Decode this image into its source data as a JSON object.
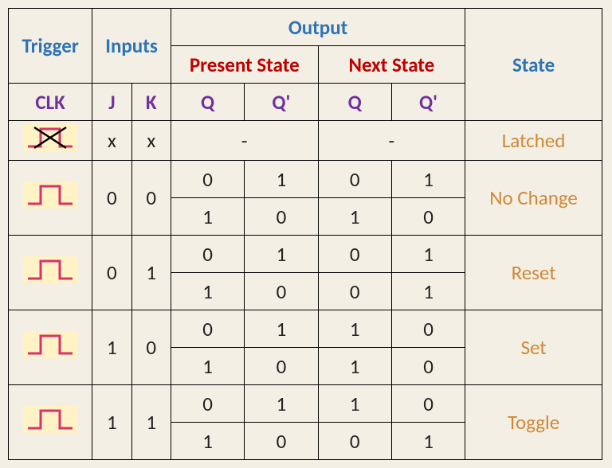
{
  "headers": {
    "trigger": "Trigger",
    "inputs": "Inputs",
    "output": "Output",
    "state": "State",
    "present": "Present State",
    "next": "Next State",
    "clk": "CLK",
    "j": "J",
    "k": "K",
    "q": "Q",
    "qbar": "Q'"
  },
  "rows": {
    "r0": {
      "j": "x",
      "k": "x",
      "ps": "-",
      "ns": "-",
      "state": "Latched"
    },
    "r1": {
      "j": "0",
      "k": "0",
      "state": "No Change",
      "a": {
        "psq": "0",
        "psqb": "1",
        "nsq": "0",
        "nsqb": "1"
      },
      "b": {
        "psq": "1",
        "psqb": "0",
        "nsq": "1",
        "nsqb": "0"
      }
    },
    "r2": {
      "j": "0",
      "k": "1",
      "state": "Reset",
      "a": {
        "psq": "0",
        "psqb": "1",
        "nsq": "0",
        "nsqb": "1"
      },
      "b": {
        "psq": "1",
        "psqb": "0",
        "nsq": "0",
        "nsqb": "1"
      }
    },
    "r3": {
      "j": "1",
      "k": "0",
      "state": "Set",
      "a": {
        "psq": "0",
        "psqb": "1",
        "nsq": "1",
        "nsqb": "0"
      },
      "b": {
        "psq": "1",
        "psqb": "0",
        "nsq": "1",
        "nsqb": "0"
      }
    },
    "r4": {
      "j": "1",
      "k": "1",
      "state": "Toggle",
      "a": {
        "psq": "0",
        "psqb": "1",
        "nsq": "1",
        "nsqb": "0"
      },
      "b": {
        "psq": "1",
        "psqb": "0",
        "nsq": "0",
        "nsqb": "1"
      }
    }
  },
  "chart_data": {
    "type": "table",
    "title": "JK Flip-Flop Truth Table",
    "columns": [
      "CLK",
      "J",
      "K",
      "Present Q",
      "Present Q'",
      "Next Q",
      "Next Q'",
      "State"
    ],
    "rows": [
      [
        "no-trigger",
        "x",
        "x",
        "-",
        "-",
        "-",
        "-",
        "Latched"
      ],
      [
        "pulse",
        0,
        0,
        0,
        1,
        0,
        1,
        "No Change"
      ],
      [
        "pulse",
        0,
        0,
        1,
        0,
        1,
        0,
        "No Change"
      ],
      [
        "pulse",
        0,
        1,
        0,
        1,
        0,
        1,
        "Reset"
      ],
      [
        "pulse",
        0,
        1,
        1,
        0,
        0,
        1,
        "Reset"
      ],
      [
        "pulse",
        1,
        0,
        0,
        1,
        1,
        0,
        "Set"
      ],
      [
        "pulse",
        1,
        0,
        1,
        0,
        1,
        0,
        "Set"
      ],
      [
        "pulse",
        1,
        1,
        0,
        1,
        1,
        0,
        "Toggle"
      ],
      [
        "pulse",
        1,
        1,
        1,
        0,
        0,
        1,
        "Toggle"
      ]
    ]
  }
}
